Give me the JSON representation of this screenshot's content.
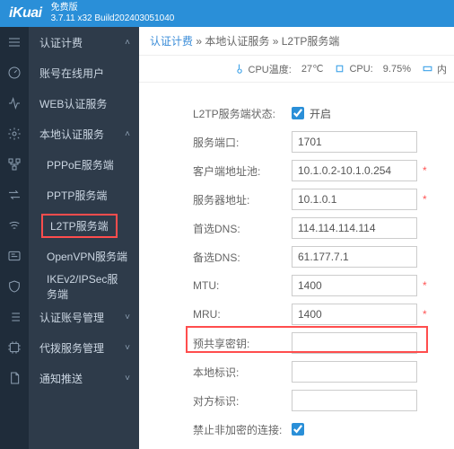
{
  "header": {
    "brand": "iKuai",
    "edition": "免费版",
    "version": "3.7.11 x32 Build202403051040"
  },
  "breadcrumb": {
    "a": "认证计费",
    "b": "本地认证服务",
    "c": "L2TP服务端"
  },
  "status": {
    "temp_label": "CPU温度:",
    "temp_value": "27℃",
    "cpu_label": "CPU:",
    "cpu_value": "9.75%",
    "disk_label": "内"
  },
  "sidebar": {
    "items": [
      {
        "label": "认证计费",
        "chev": "˄"
      },
      {
        "label": "账号在线用户"
      },
      {
        "label": "WEB认证服务"
      },
      {
        "label": "本地认证服务",
        "chev": "˄"
      },
      {
        "label": "PPPoE服务端",
        "sub": true
      },
      {
        "label": "PPTP服务端",
        "sub": true
      },
      {
        "label": "L2TP服务端",
        "sub": true,
        "selected": true
      },
      {
        "label": "OpenVPN服务端",
        "sub": true
      },
      {
        "label": "IKEv2/IPSec服务端",
        "sub": true
      },
      {
        "label": "认证账号管理",
        "chev": "˅"
      },
      {
        "label": "代拨服务管理",
        "chev": "˅"
      },
      {
        "label": "通知推送",
        "chev": "˅"
      }
    ]
  },
  "form": {
    "status_label": "L2TP服务端状态:",
    "status_value": "开启",
    "port_label": "服务端口:",
    "port_value": "1701",
    "pool_label": "客户端地址池:",
    "pool_value": "10.1.0.2-10.1.0.254",
    "server_label": "服务器地址:",
    "server_value": "10.1.0.1",
    "dns1_label": "首选DNS:",
    "dns1_value": "114.114.114.114",
    "dns2_label": "备选DNS:",
    "dns2_value": "61.177.7.1",
    "mtu_label": "MTU:",
    "mtu_value": "1400",
    "mru_label": "MRU:",
    "mru_value": "1400",
    "psk_label": "预共享密钥:",
    "psk_value": "",
    "localid_label": "本地标识:",
    "localid_value": "",
    "peerid_label": "对方标识:",
    "peerid_value": "",
    "noenc_label": "禁止非加密的连接:"
  }
}
